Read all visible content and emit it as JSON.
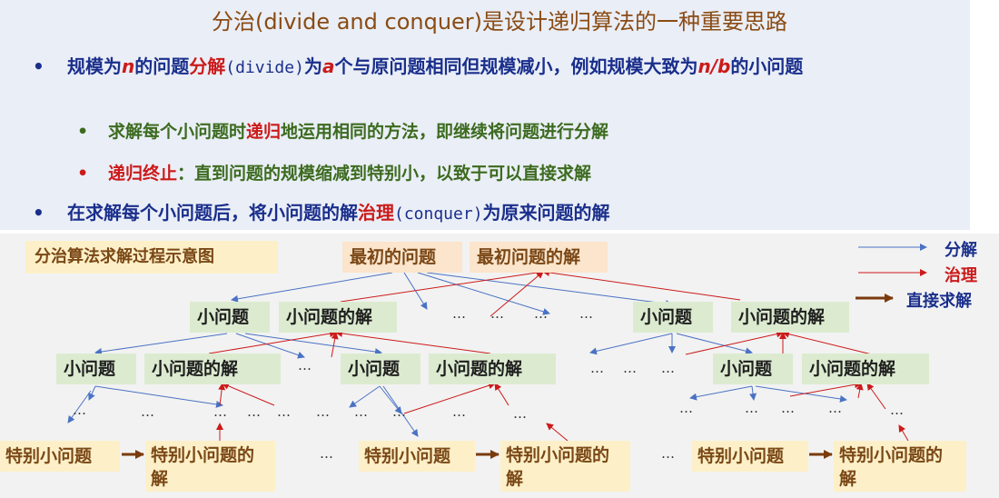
{
  "slide": {
    "title": "分治(divide and conquer)是设计递归算法的一种重要思路",
    "bullet1": {
      "marker": "•",
      "t1": "规模为",
      "n": "n",
      "t2": "的问题",
      "fenjie": "分解",
      "divide": "(divide)",
      "t3": "为",
      "a": "a",
      "t4": "个与原问题相同但规模减小，例如规模大致为",
      "nb": "n/b",
      "t5": "的小问题"
    },
    "bullet2": {
      "marker": "•",
      "t1": "求解每个小问题时",
      "digui": "递归",
      "t2": "地运用相同的方法，即继续将问题进行分解"
    },
    "bullet3": {
      "marker": "•",
      "red": "递归终止",
      "t": "：直到问题的规模缩减到特别小，以致于可以直接求解"
    },
    "bullet4": {
      "marker": "•",
      "t1": "在求解每个小问题后，将小问题的解",
      "zhili": "治理",
      "conquer": "(conquer)",
      "t2": "为原来问题的解"
    }
  },
  "diagram": {
    "caption": "分治算法求解过程示意图",
    "root_problem": "最初的问题",
    "root_solution": "最初问题的解",
    "subproblem": "小问题",
    "subsolution": "小问题的解",
    "base_problem": "特别小问题",
    "base_solution_line1": "特别小问题的",
    "base_solution_line2": "解",
    "ellipsis": "…",
    "legend": {
      "divide": "分解",
      "conquer": "治理",
      "direct": "直接求解"
    },
    "colors": {
      "divide": "#4a72c4",
      "conquer": "#cc1a1a",
      "direct": "#7a3b0c"
    }
  }
}
